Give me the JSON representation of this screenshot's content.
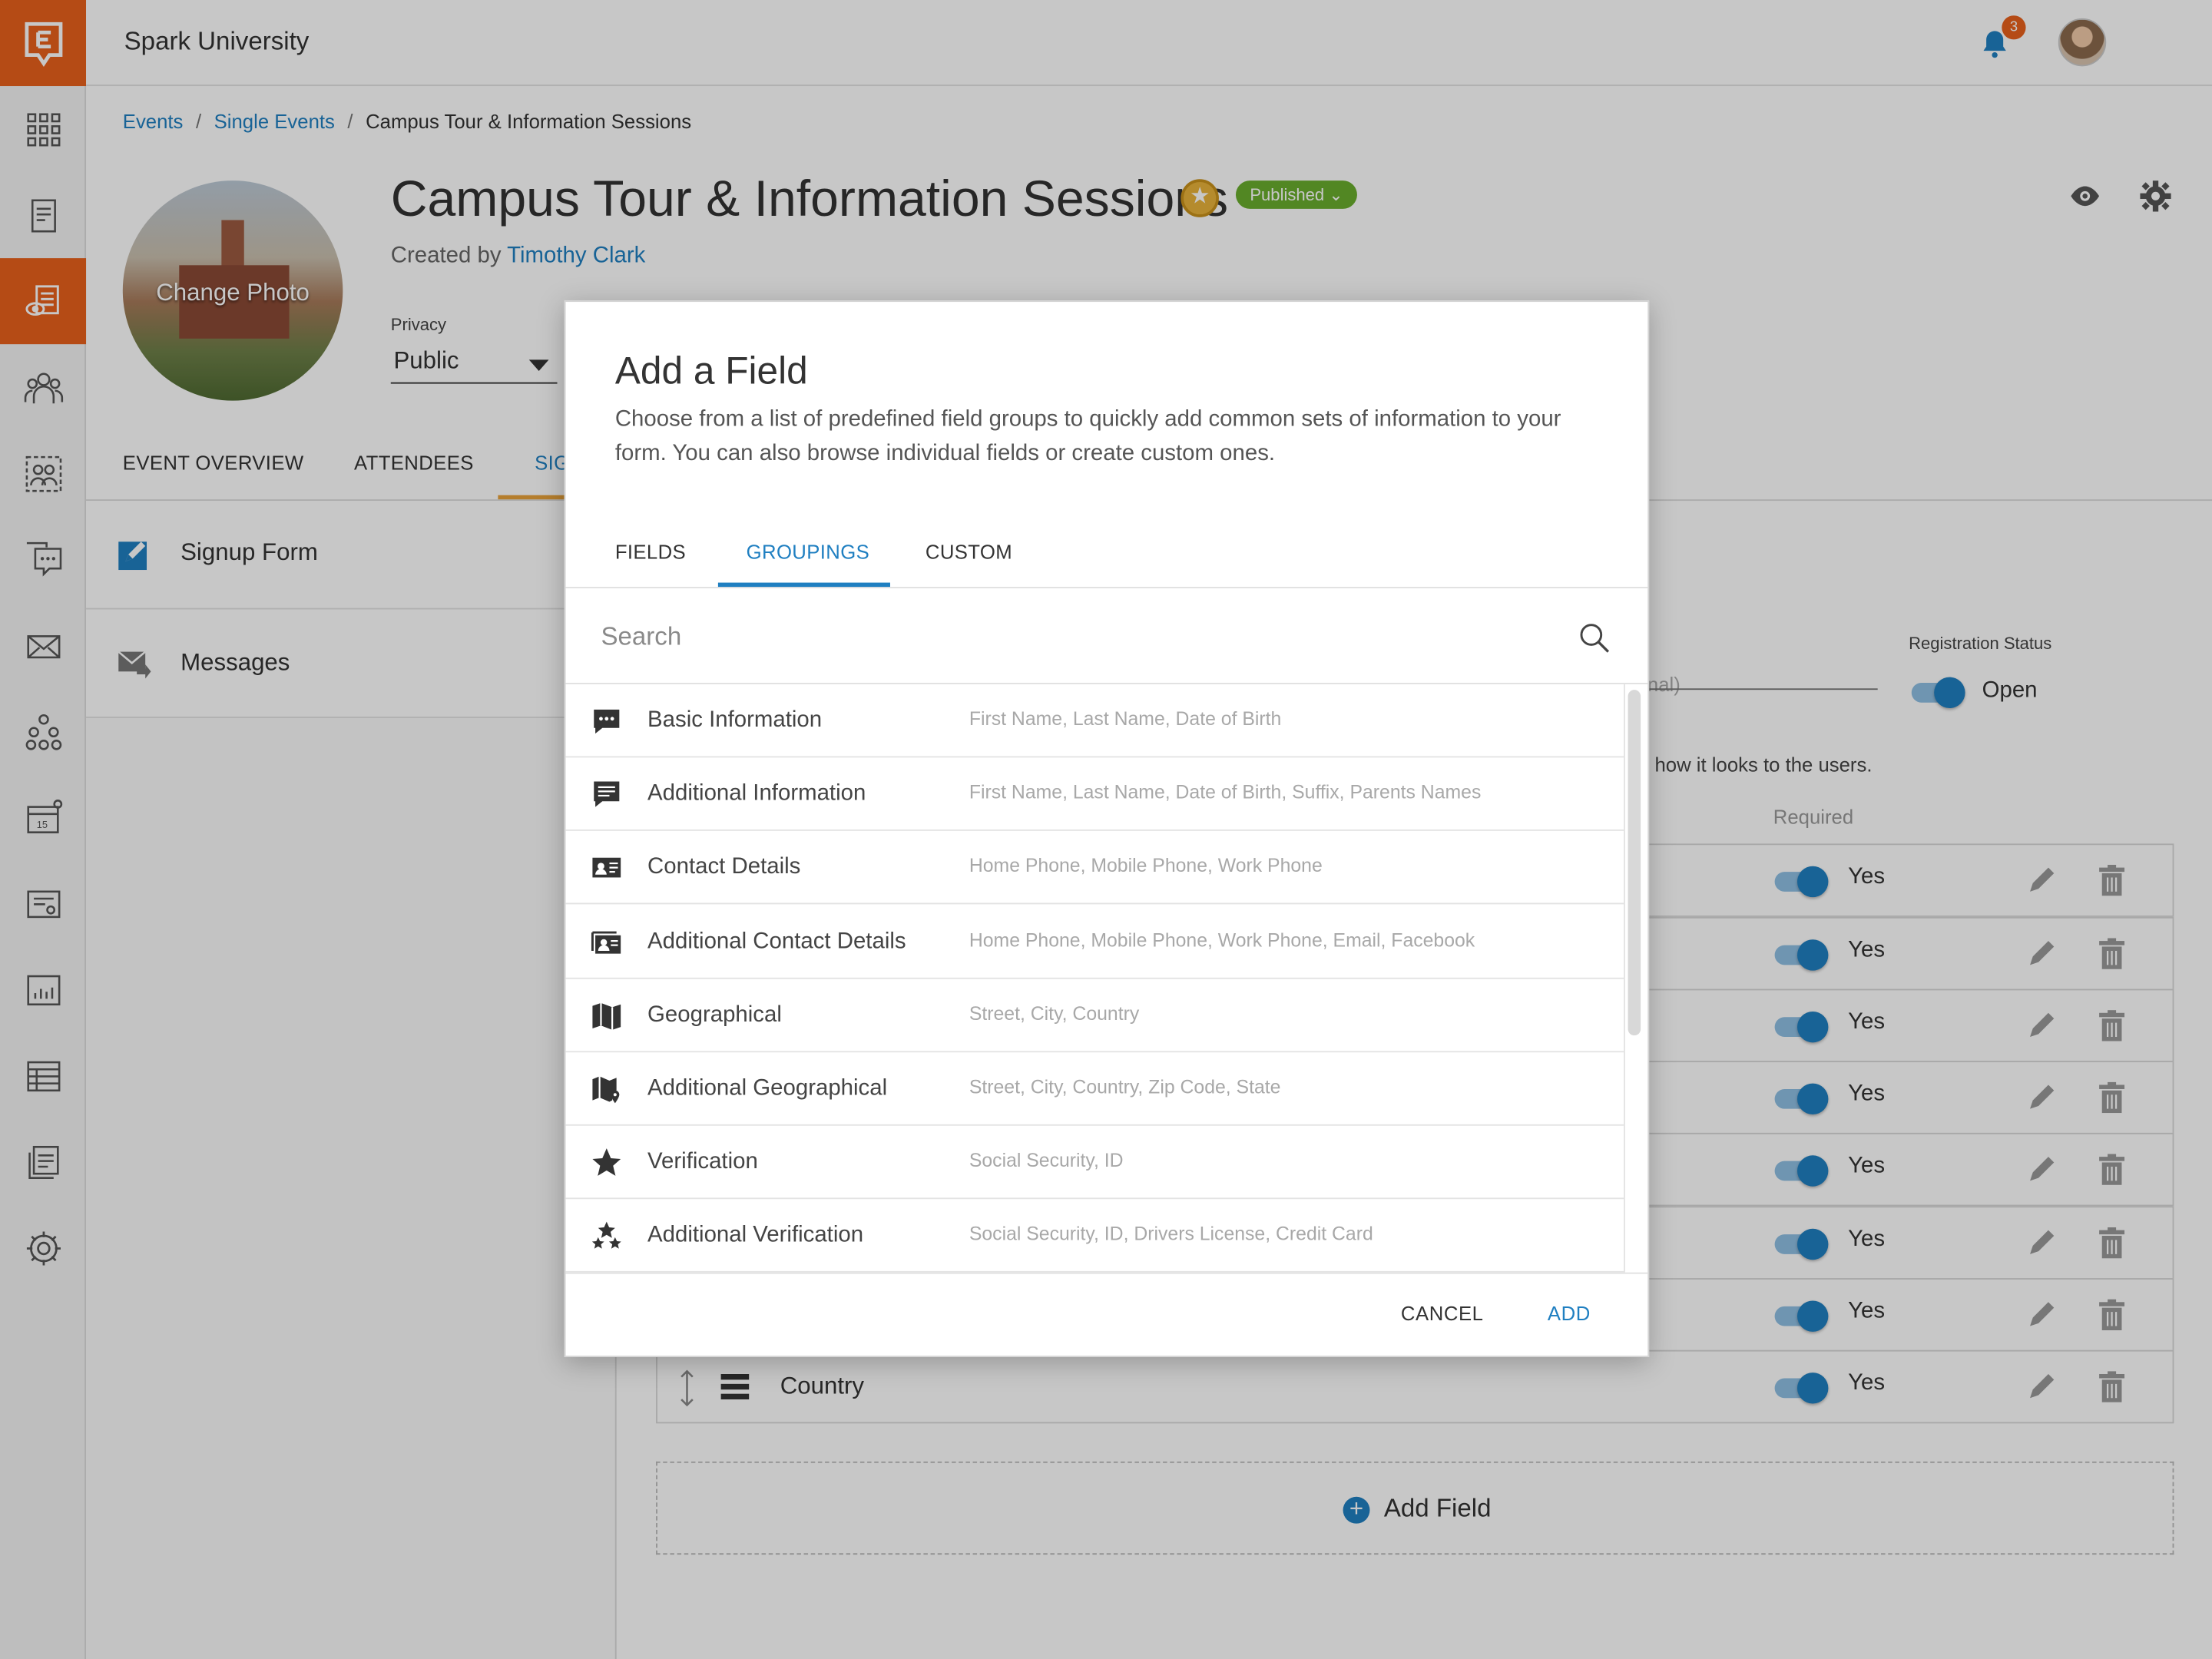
{
  "app": {
    "org_name": "Spark University",
    "notification_count": "3"
  },
  "breadcrumb": {
    "item1": "Events",
    "item2": "Single Events",
    "item3": "Campus Tour & Information Sessions"
  },
  "event": {
    "title": "Campus Tour & Information Sessions",
    "status": "Published ⌄",
    "created_by_prefix": "Created by",
    "creator": "Timothy Clark",
    "change_photo": "Change Photo",
    "privacy_label": "Privacy",
    "privacy_value": "Public"
  },
  "page_tabs": {
    "overview": "EVENT OVERVIEW",
    "attendees": "ATTENDEES",
    "signup": "SIG"
  },
  "subnav": {
    "signup": "Signup Form",
    "messages": "Messages"
  },
  "form": {
    "description_placeholder": "onal)",
    "registration_status_label": "Registration Status",
    "registration_status_value": "Open",
    "hint": "how it looks to the users.",
    "required_header": "Required",
    "rows": [
      {
        "name": "",
        "required": "Yes"
      },
      {
        "name": "",
        "required": "Yes"
      },
      {
        "name": "",
        "required": "Yes"
      },
      {
        "name": "",
        "required": "Yes"
      },
      {
        "name": "",
        "required": "Yes"
      },
      {
        "name": "",
        "required": "Yes"
      },
      {
        "name": "",
        "required": "Yes"
      },
      {
        "name": "Country",
        "required": "Yes"
      }
    ],
    "add_field": "Add Field"
  },
  "modal": {
    "title": "Add a Field",
    "subtitle": "Choose from a list of predefined field groups to quickly add common sets of information to your form. You can also browse individual fields or create custom ones.",
    "tabs": {
      "fields": "FIELDS",
      "groupings": "GROUPINGS",
      "custom": "CUSTOM"
    },
    "search_placeholder": "Search",
    "groups": [
      {
        "name": "Basic Information",
        "fields": "First Name, Last Name, Date of Birth",
        "icon": "chat-bubble-icon"
      },
      {
        "name": "Additional Information",
        "fields": "First Name, Last Name, Date of Birth, Suffix, Parents Names",
        "icon": "message-icon"
      },
      {
        "name": "Contact Details",
        "fields": "Home Phone, Mobile Phone, Work Phone",
        "icon": "contact-card-icon"
      },
      {
        "name": "Additional Contact Details",
        "fields": "Home Phone, Mobile Phone, Work Phone, Email, Facebook",
        "icon": "contact-cards-icon"
      },
      {
        "name": "Geographical",
        "fields": "Street, City, Country",
        "icon": "map-icon"
      },
      {
        "name": "Additional Geographical",
        "fields": "Street, City, Country, Zip Code, State",
        "icon": "map-pin-icon"
      },
      {
        "name": "Verification",
        "fields": "Social Security, ID",
        "icon": "star-icon"
      },
      {
        "name": "Additional Verification",
        "fields": "Social Security, ID, Drivers License, Credit Card",
        "icon": "stars-icon"
      }
    ],
    "cancel": "CANCEL",
    "add": "ADD"
  },
  "colors": {
    "brand": "#e8601c",
    "accent": "#1f7fc1",
    "published": "#6aad2e"
  }
}
